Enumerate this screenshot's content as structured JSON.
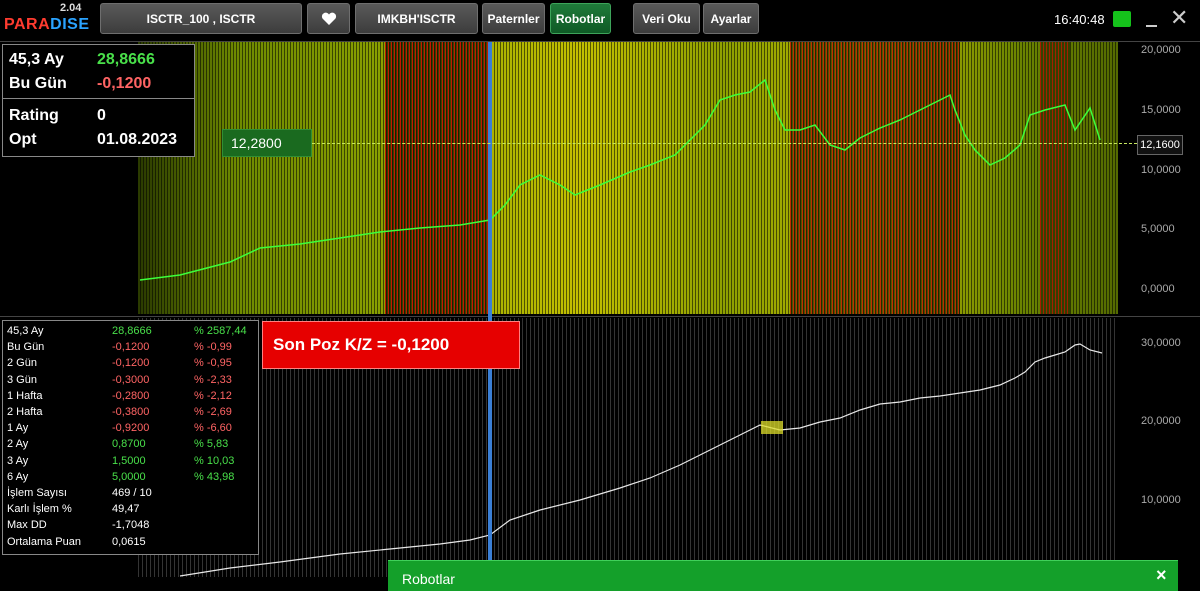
{
  "app": {
    "version": "2.04",
    "logo_part1": "PARA",
    "logo_part2": "DISE"
  },
  "toolbar": {
    "symbol_label": "ISCTR_100 , ISCTR",
    "index_label": "IMKBH'ISCTR",
    "patterns_label": "Paternler",
    "robots_label": "Robotlar",
    "data_read_label": "Veri Oku",
    "settings_label": "Ayarlar"
  },
  "clock": "16:40:48",
  "info_box": {
    "r1_label": "45,3 Ay",
    "r1_value": "28,8666",
    "r2_label": "Bu Gün",
    "r2_value": "-0,1200",
    "r3_label": "Rating",
    "r3_value": "0",
    "r4_label": "Opt",
    "r4_value": "01.08.2023"
  },
  "upper_chart": {
    "current_price_tag": "12,2800",
    "last_price": "12,1600",
    "axis": [
      "20,0000",
      "15,0000",
      "10,0000",
      "5,0000",
      "0,0000"
    ]
  },
  "lower_chart": {
    "axis": [
      "30,0000",
      "20,0000",
      "10,0000"
    ]
  },
  "son_poz": "Son Poz K/Z  =  -0,1200",
  "stats": [
    {
      "label": "45,3 Ay",
      "value": "28,8666",
      "pct": "% 2587,44",
      "sign": "pos"
    },
    {
      "label": "Bu Gün",
      "value": "-0,1200",
      "pct": "% -0,99",
      "sign": "neg"
    },
    {
      "label": "2 Gün",
      "value": "-0,1200",
      "pct": "% -0,95",
      "sign": "neg"
    },
    {
      "label": "3 Gün",
      "value": "-0,3000",
      "pct": "% -2,33",
      "sign": "neg"
    },
    {
      "label": "1 Hafta",
      "value": "-0,2800",
      "pct": "% -2,12",
      "sign": "neg"
    },
    {
      "label": "2 Hafta",
      "value": "-0,3800",
      "pct": "% -2,69",
      "sign": "neg"
    },
    {
      "label": "1 Ay",
      "value": "-0,9200",
      "pct": "% -6,60",
      "sign": "neg"
    },
    {
      "label": "2 Ay",
      "value": "0,8700",
      "pct": "% 5,83",
      "sign": "pos"
    },
    {
      "label": "3 Ay",
      "value": "1,5000",
      "pct": "% 10,03",
      "sign": "pos"
    },
    {
      "label": "6 Ay",
      "value": "5,0000",
      "pct": "% 43,98",
      "sign": "pos"
    },
    {
      "label": "İşlem Sayısı",
      "value": "469 / 10",
      "pct": "",
      "sign": "wht"
    },
    {
      "label": "Karlı İşlem %",
      "value": "49,47",
      "pct": "",
      "sign": "wht"
    },
    {
      "label": "Max DD",
      "value": "-1,7048",
      "pct": "",
      "sign": "wht"
    },
    {
      "label": "Ortalama Puan",
      "value": "0,0615",
      "pct": "",
      "sign": "wht"
    }
  ],
  "robot_panel": {
    "title": "Robotlar",
    "close": "×"
  },
  "colors": {
    "accent_green": "#15c21b",
    "loss_red": "#e60000",
    "profit_green": "#49e04a"
  }
}
